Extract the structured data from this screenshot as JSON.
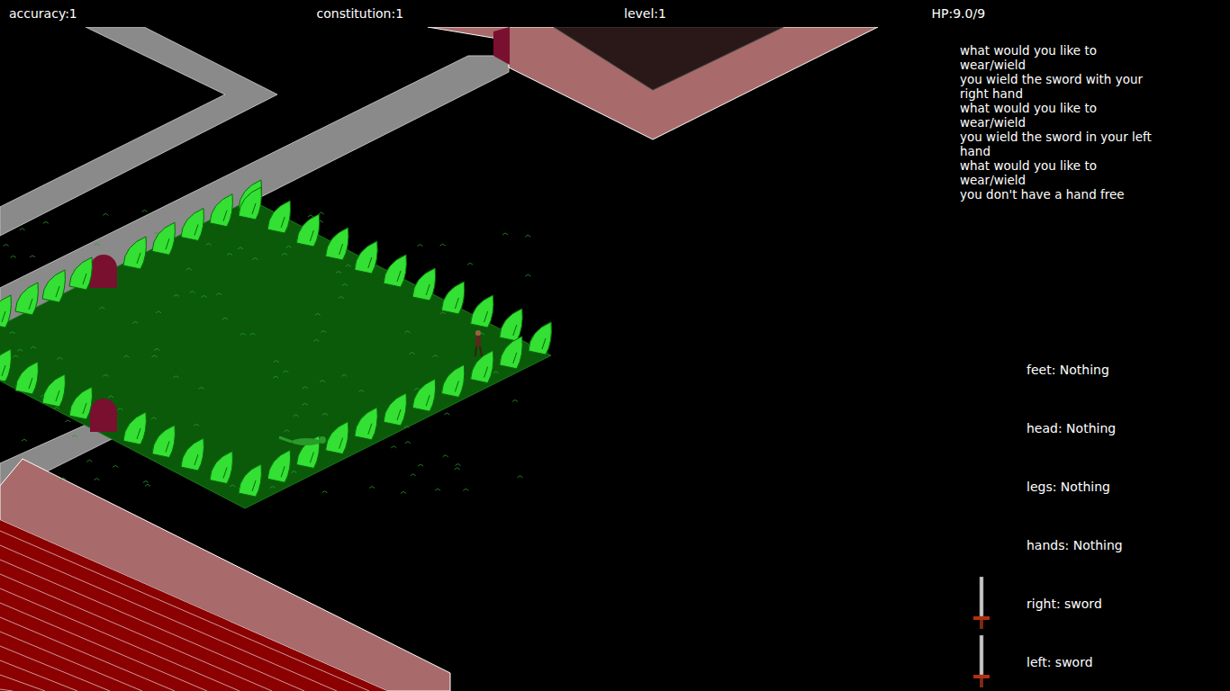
{
  "stats": [
    {
      "label": "accuracy:1"
    },
    {
      "label": "constitution:1"
    },
    {
      "label": "level:1"
    },
    {
      "label": "HP:9.0/9"
    }
  ],
  "messages": [
    "what would you like to wear/wield",
    "you wield the sword with your right hand",
    "what would you like to wear/wield",
    "you wield the sword in your left hand",
    "what would you like to wear/wield",
    "you don't have a hand free"
  ],
  "equipment": [
    {
      "label": "feet: Nothing",
      "equipped": false
    },
    {
      "label": "head: Nothing",
      "equipped": false
    },
    {
      "label": "legs: Nothing",
      "equipped": false
    },
    {
      "label": "hands: Nothing",
      "equipped": false
    },
    {
      "label": "right: sword",
      "equipped": true
    },
    {
      "label": "left: sword",
      "equipped": true
    }
  ]
}
